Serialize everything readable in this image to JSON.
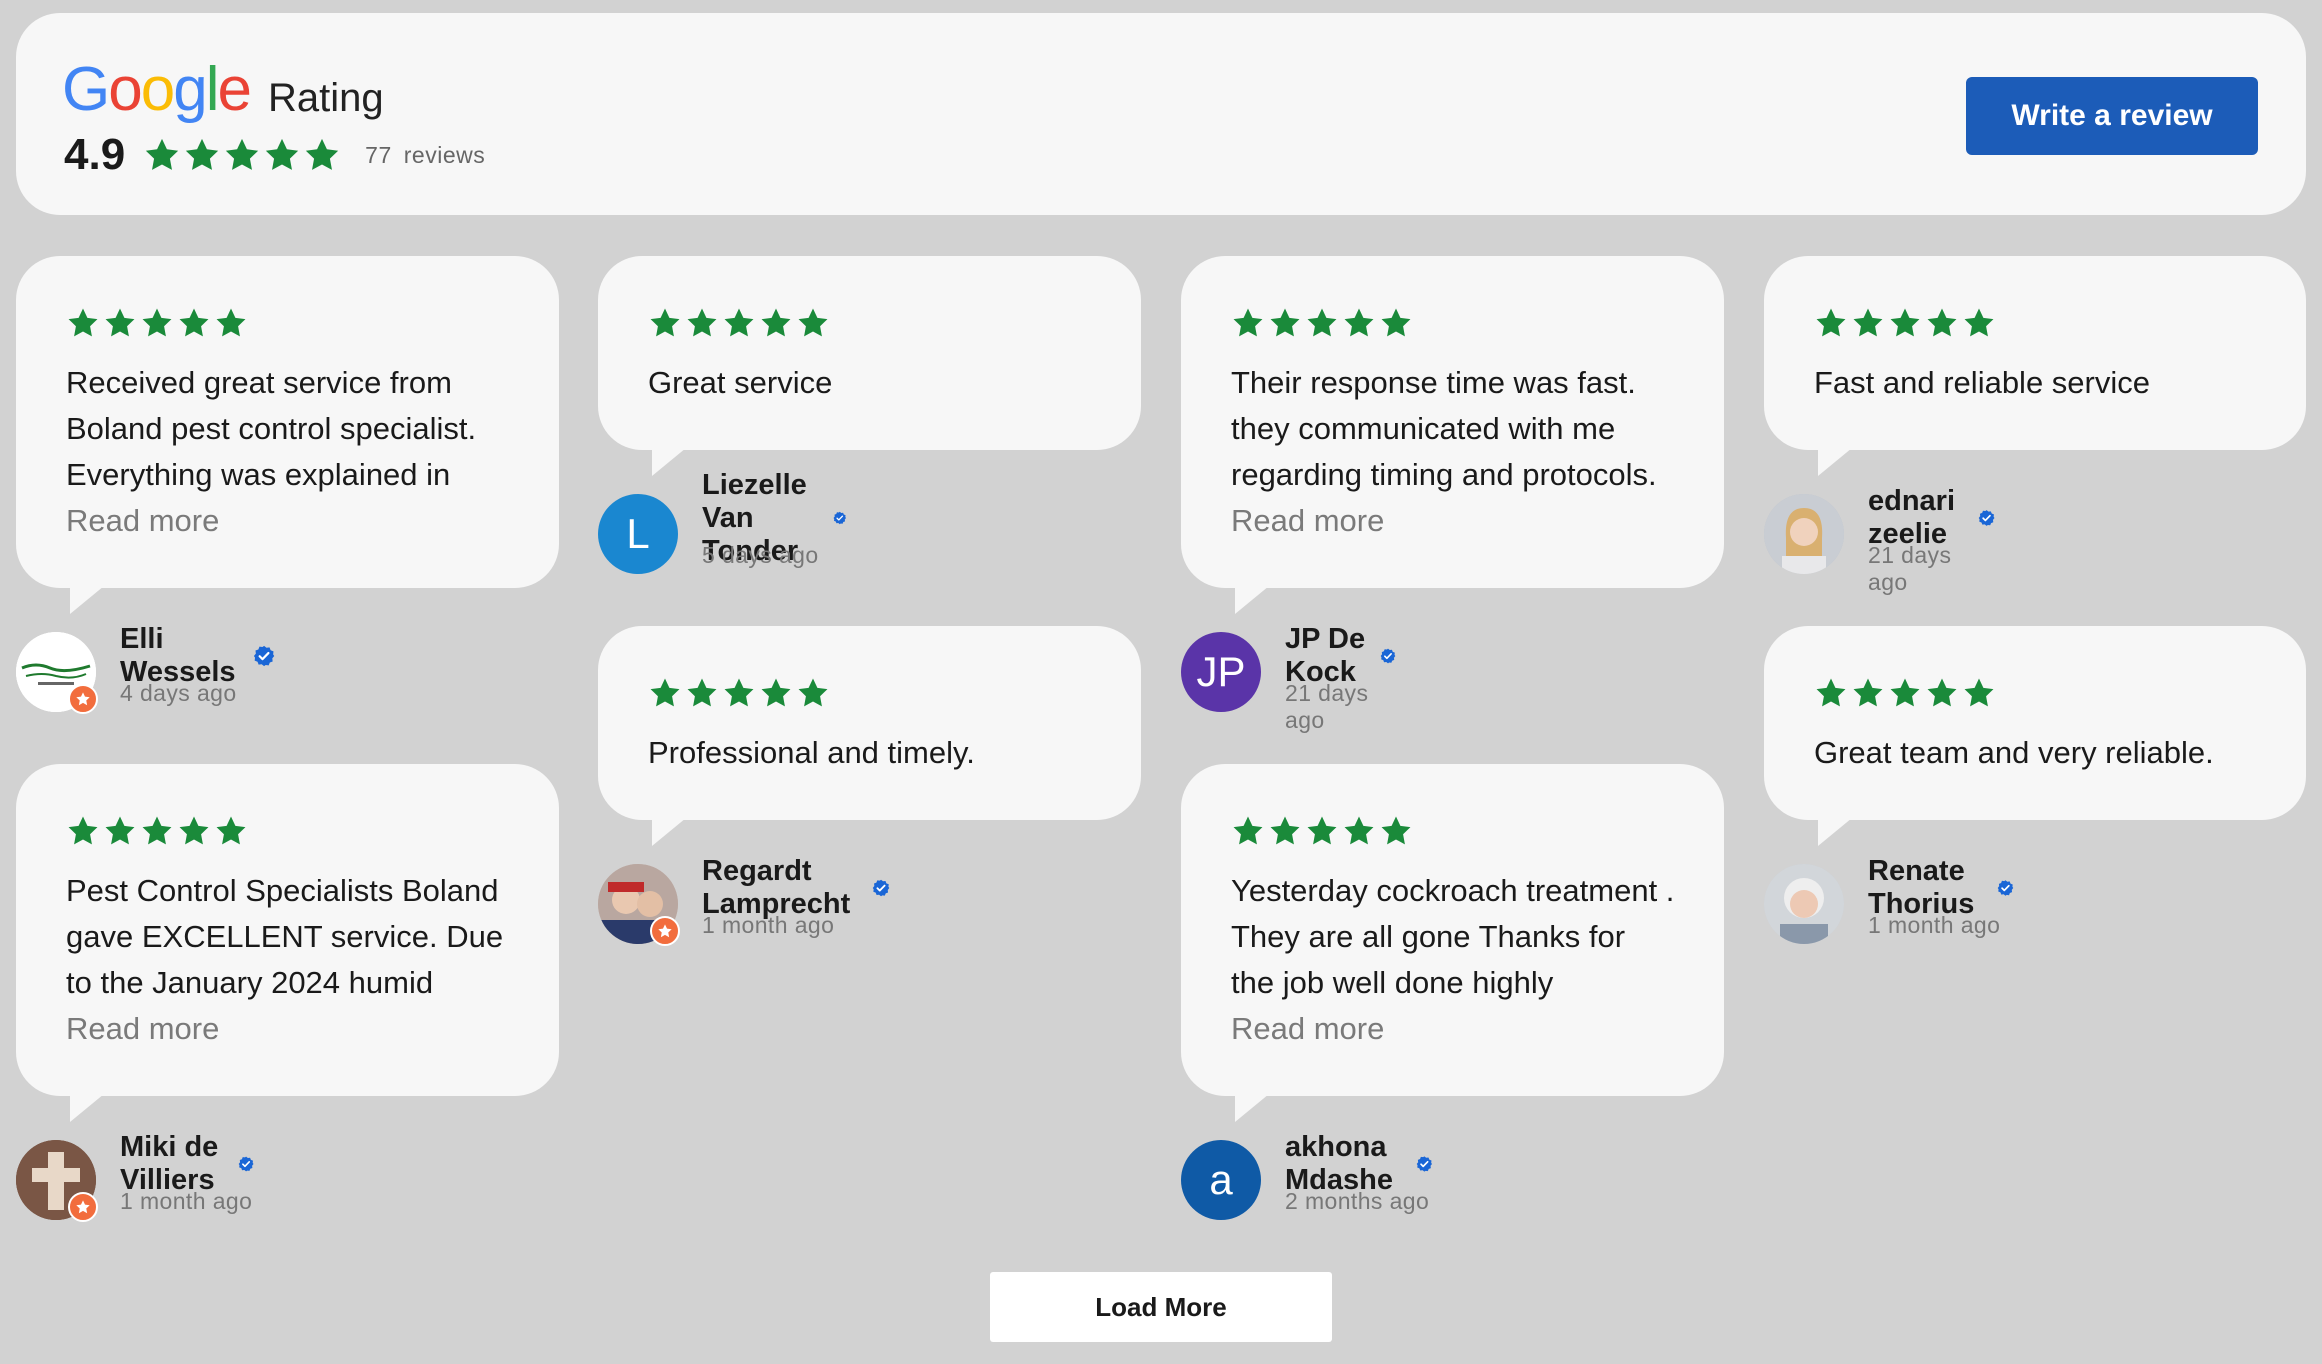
{
  "header": {
    "logo_text": "Google",
    "rating_label": "Rating",
    "score": "4.9",
    "review_count": "77",
    "reviews_label": "reviews",
    "write_review_label": "Write a review"
  },
  "colors": {
    "star_green": "#1a8a3a",
    "button_blue": "#1c5cb8",
    "verified_blue": "#1a66d6"
  },
  "reviews": [
    {
      "text": "Received great service from Boland pest control specialist. Everything was explained in",
      "read_more": "Read more",
      "name": "Elli Wessels",
      "time": "4 days ago",
      "avatar_letter": ""
    },
    {
      "text": "Pest Control Specialists Boland gave EXCELLENT service. Due to the January 2024 humid",
      "read_more": "Read more",
      "name": "Miki de Villiers",
      "time": "1 month ago",
      "avatar_letter": ""
    },
    {
      "text": "Great service",
      "read_more": "",
      "name": "Liezelle Van Tonder",
      "time": "5 days ago",
      "avatar_letter": "L"
    },
    {
      "text": "Professional and timely.",
      "read_more": "",
      "name": "Regardt Lamprecht",
      "time": "1 month ago",
      "avatar_letter": ""
    },
    {
      "text": "Their response time was fast. they communicated with me regarding timing and protocols.",
      "read_more": "Read more",
      "name": "JP De Kock",
      "time": "21 days ago",
      "avatar_letter": "JP"
    },
    {
      "text": "Yesterday cockroach treatment . They are all gone Thanks for the job well done highly",
      "read_more": "Read more",
      "name": "akhona Mdashe",
      "time": "2 months ago",
      "avatar_letter": "a"
    },
    {
      "text": "Fast and reliable service",
      "read_more": "",
      "name": "ednari zeelie",
      "time": "21 days ago",
      "avatar_letter": ""
    },
    {
      "text": "Great team and very reliable.",
      "read_more": "",
      "name": "Renate Thorius",
      "time": "1 month ago",
      "avatar_letter": ""
    }
  ],
  "load_more_label": "Load More"
}
